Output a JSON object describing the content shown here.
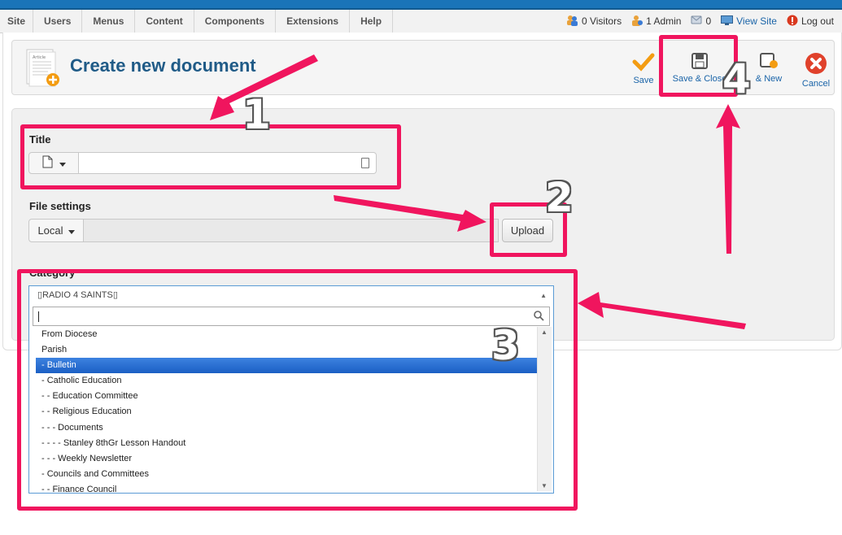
{
  "menu": [
    "Site",
    "Users",
    "Menus",
    "Content",
    "Components",
    "Extensions",
    "Help"
  ],
  "status": {
    "visitors": "0 Visitors",
    "admin": "1 Admin",
    "messages": "0",
    "view_site": "View Site",
    "logout": "Log out"
  },
  "header": {
    "title": "Create new document",
    "icon_text": "Article"
  },
  "toolbar": {
    "save": "Save",
    "save_close": "Save & Close",
    "save_new": "& New",
    "cancel": "Cancel"
  },
  "form": {
    "title_label": "Title",
    "title_value": "",
    "file_label": "File settings",
    "file_source": "Local",
    "upload": "Upload",
    "category_label": "Category"
  },
  "category": {
    "selected_label": "▯RADIO 4 SAINTS▯",
    "search_value": "",
    "items": [
      "From Diocese",
      "Parish",
      "- Bulletin",
      "- Catholic Education",
      "- - Education Committee",
      "- - Religious Education",
      "- - - Documents",
      "- - - - Stanley 8thGr Lesson Handout",
      "- - - Weekly Newsletter",
      "- Councils and Committees",
      "- - Finance Council"
    ],
    "selected_index": 2
  },
  "annotations": {
    "n1": "1",
    "n2": "2",
    "n3": "3",
    "n4": "4",
    "color": "#f0155e"
  },
  "colors": {
    "top_stripe": "#1a74b8",
    "title_blue": "#205b87",
    "link_blue": "#1a64a8",
    "selection": "#3875d7"
  }
}
